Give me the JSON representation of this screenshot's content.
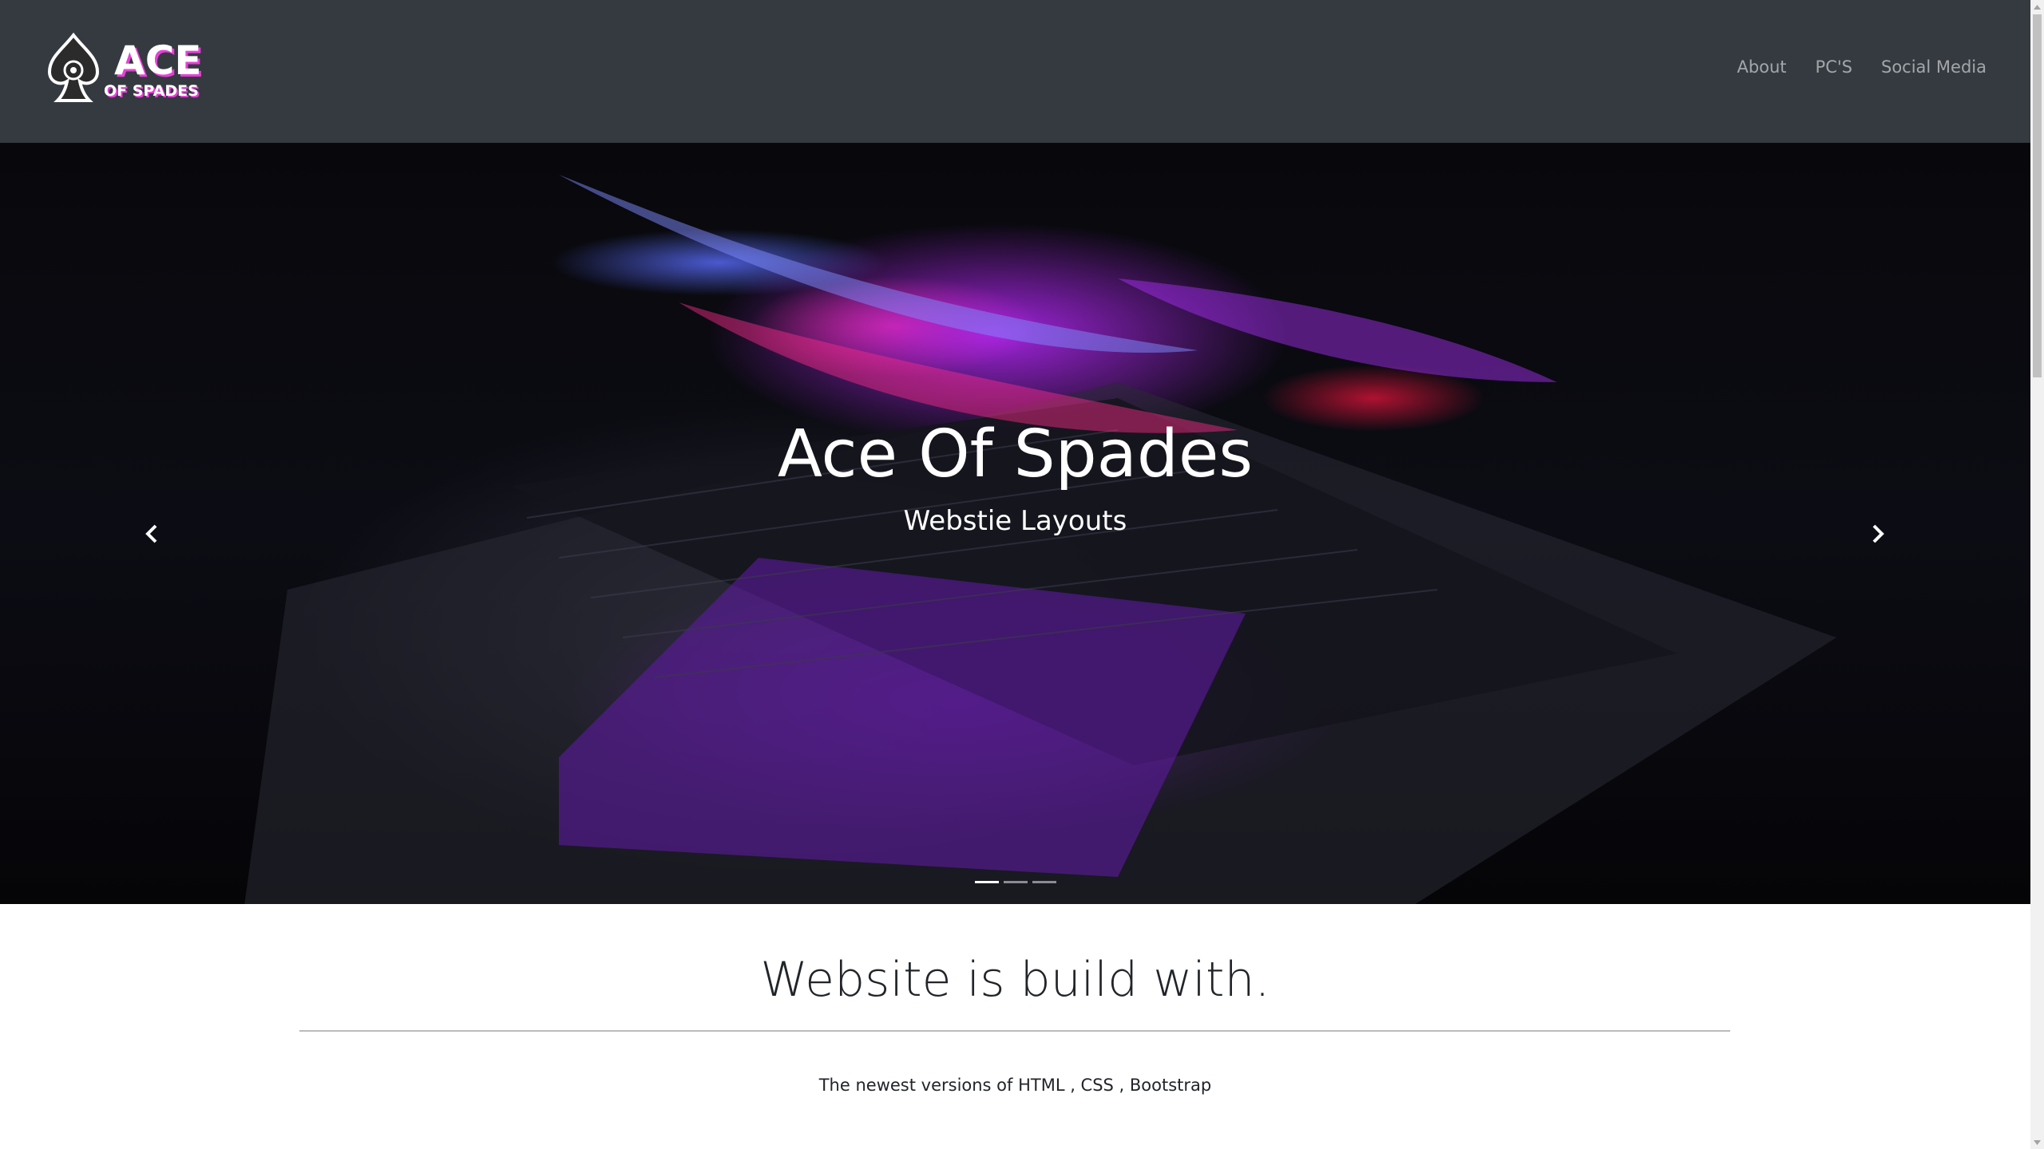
{
  "navbar": {
    "logo": {
      "line1": "ACE",
      "line2": "OF SPADES"
    },
    "links": [
      "About",
      "PC'S",
      "Social Media"
    ]
  },
  "hero": {
    "title": "Ace Of Spades",
    "subtitle": "Webstie Layouts",
    "prev_icon": "chevron-left-icon",
    "next_icon": "chevron-right-icon",
    "slides": 3,
    "active_slide": 1
  },
  "section": {
    "heading": "Website is build with.",
    "text": "The newest versions of HTML , CSS , Bootstrap"
  },
  "colors": {
    "navbar_bg": "#343a40",
    "nav_link": "rgba(255,255,255,0.55)",
    "logo_accent": "#e83fd8"
  }
}
